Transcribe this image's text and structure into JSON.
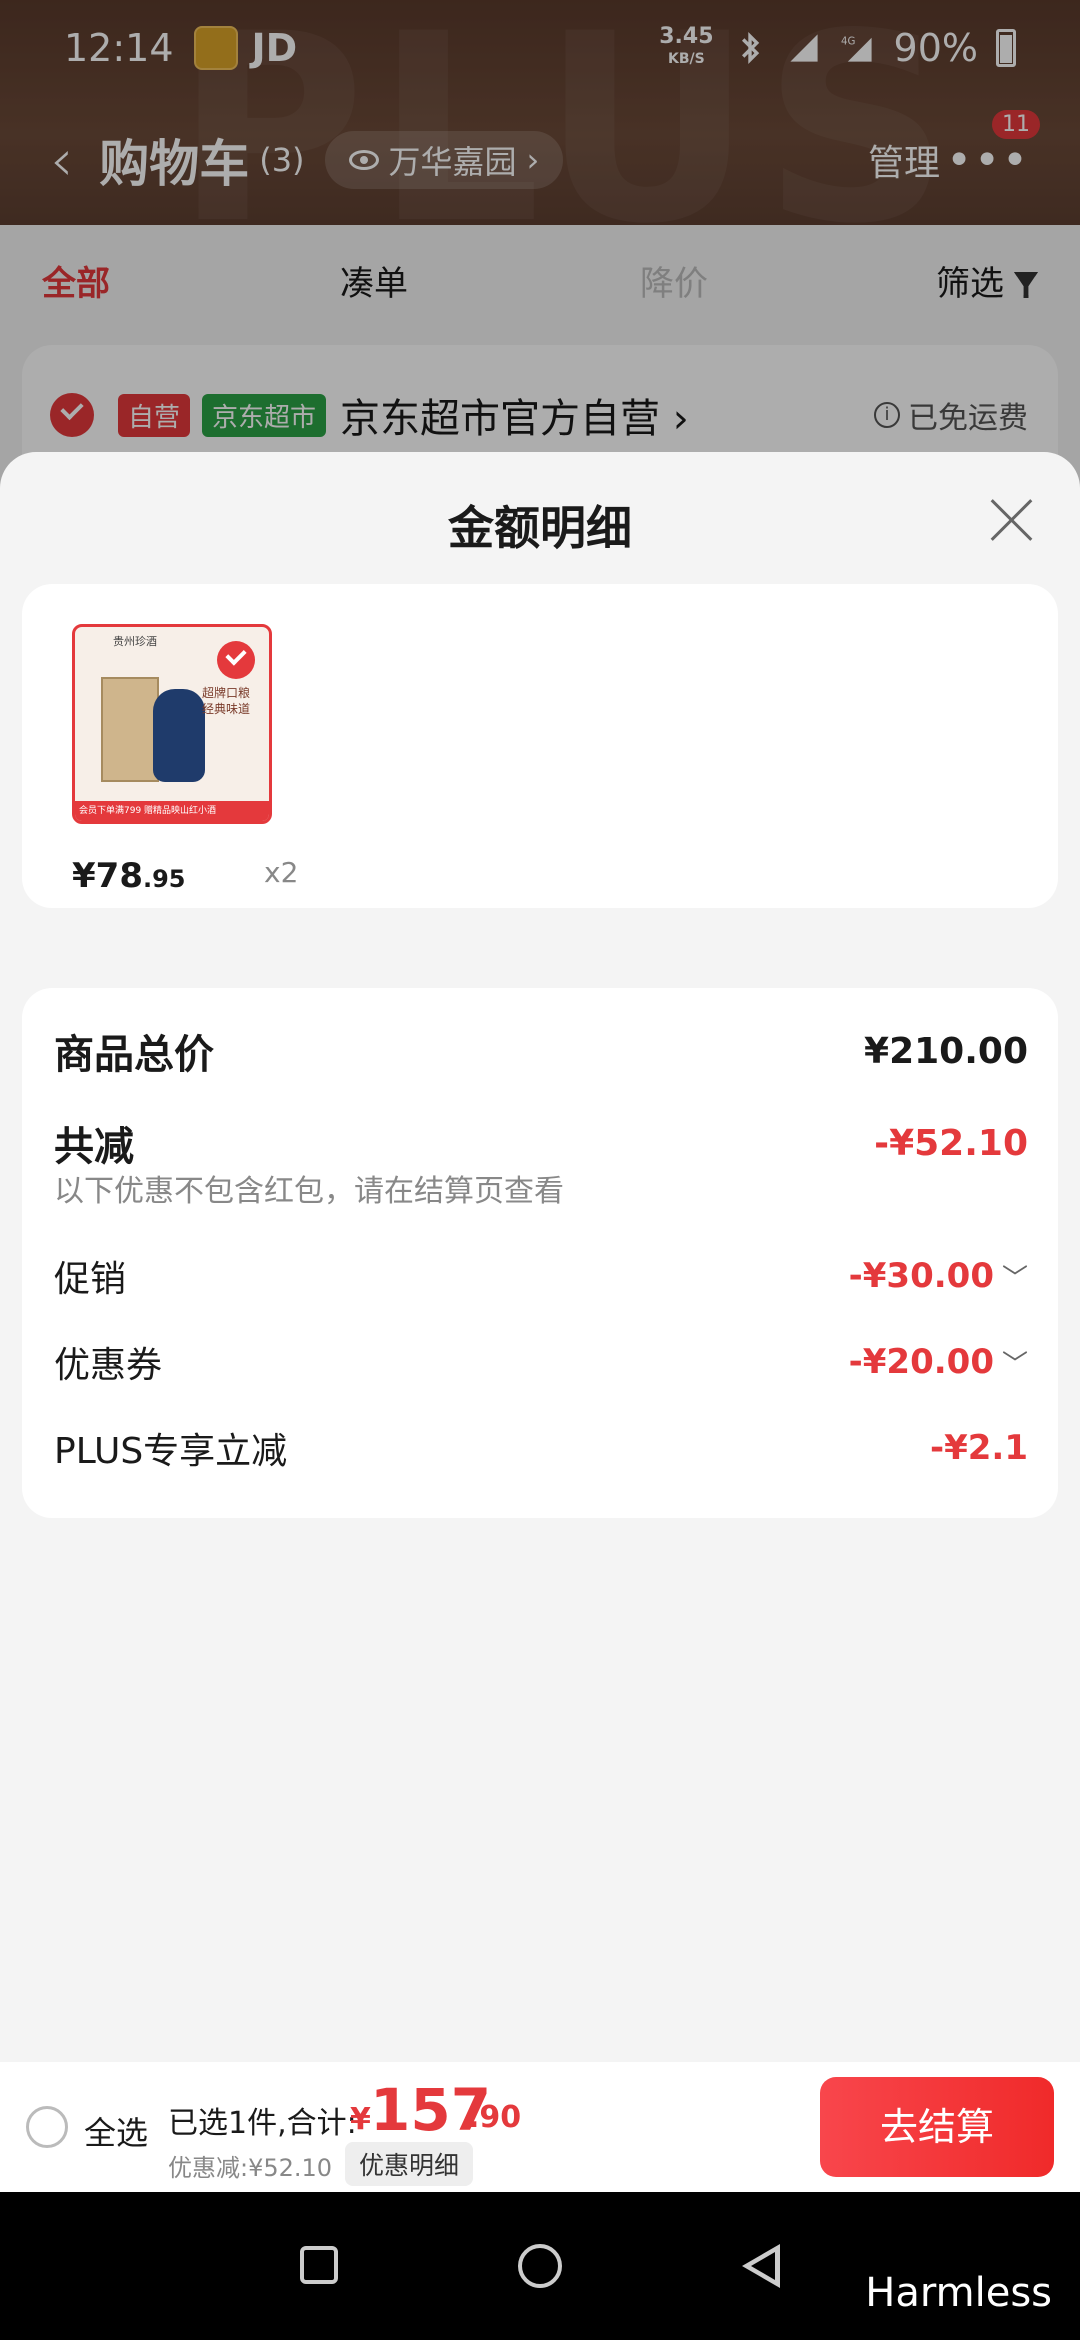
{
  "status_bar": {
    "time": "12:14",
    "carrier": "JD",
    "speed_value": "3.45",
    "speed_unit": "KB/S",
    "battery": "90%"
  },
  "header": {
    "title": "购物车",
    "count": "(3)",
    "address": "万华嘉园",
    "manage": "管理",
    "badge": "11",
    "watermark": "PLUS"
  },
  "tabs": [
    {
      "label": "全部"
    },
    {
      "label": "凑单"
    },
    {
      "label": "降价"
    },
    {
      "label": "筛选"
    }
  ],
  "store": {
    "tag_self": "自营",
    "tag_market": "京东超市",
    "name": "京东超市官方自营",
    "shipping": "已免运费"
  },
  "sheet": {
    "title": "金额明细",
    "product": {
      "price_int": "¥78",
      "price_dec": ".95",
      "qty": "x2"
    },
    "rows": {
      "total_label": "商品总价",
      "total_value": "¥210.00",
      "reduce_label": "共减",
      "reduce_value": "-¥52.10",
      "note": "以下优惠不包含红包，请在结算页查看",
      "promo_label": "促销",
      "promo_value": "-¥30.00",
      "coupon_label": "优惠券",
      "coupon_value": "-¥20.00",
      "plus_label": "PLUS专享立减",
      "plus_value": "-¥2.1"
    }
  },
  "action_bar": {
    "select_all": "全选",
    "selected": "已选1件,合计:",
    "currency": "¥",
    "total_int": "157",
    "total_dec": ".90",
    "discount": "优惠减:¥52.10",
    "detail_button": "优惠明细",
    "checkout": "去结算"
  },
  "system": {
    "watermark": "Harmless"
  },
  "colors": {
    "accent": "#e4393c",
    "header_bg": "#5a3a2c",
    "green_tag": "#2ba246"
  }
}
